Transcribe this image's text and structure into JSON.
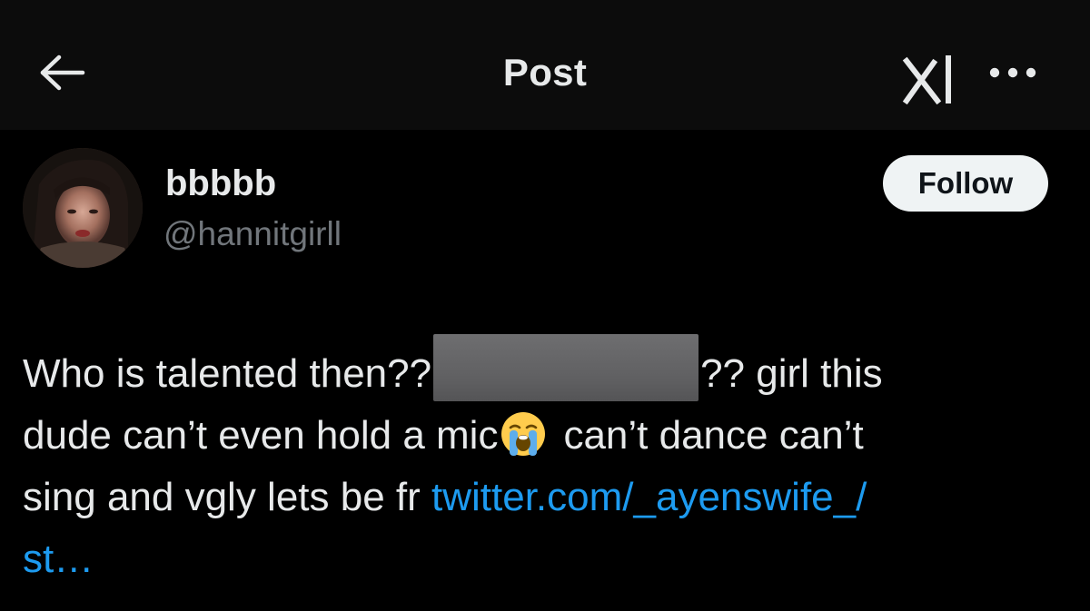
{
  "header": {
    "title": "Post",
    "back_icon": "arrow-left-icon",
    "grok_icon": "grok-icon",
    "more_icon": "more-horizontal-icon"
  },
  "author": {
    "display_name": "bbbbb",
    "handle": "@hannitgirll",
    "follow_label": "Follow"
  },
  "post": {
    "line1_before": "Who is talented then??",
    "line1_after": "?? girl this",
    "line2_before": "dude can’t even hold a mic",
    "emoji": "loudly-crying-face-emoji",
    "line2_after": "can’t dance can’t",
    "line3_text": "sing and vgly lets be fr ",
    "link_part1": "twitter.com/_ayenswife_/",
    "link_part2": "st…"
  },
  "colors": {
    "background": "#000000",
    "header_background": "#0c0c0c",
    "text_primary": "#e7e9ea",
    "text_secondary": "#71767b",
    "link": "#1d9bf0",
    "follow_bg": "#eff3f4"
  }
}
